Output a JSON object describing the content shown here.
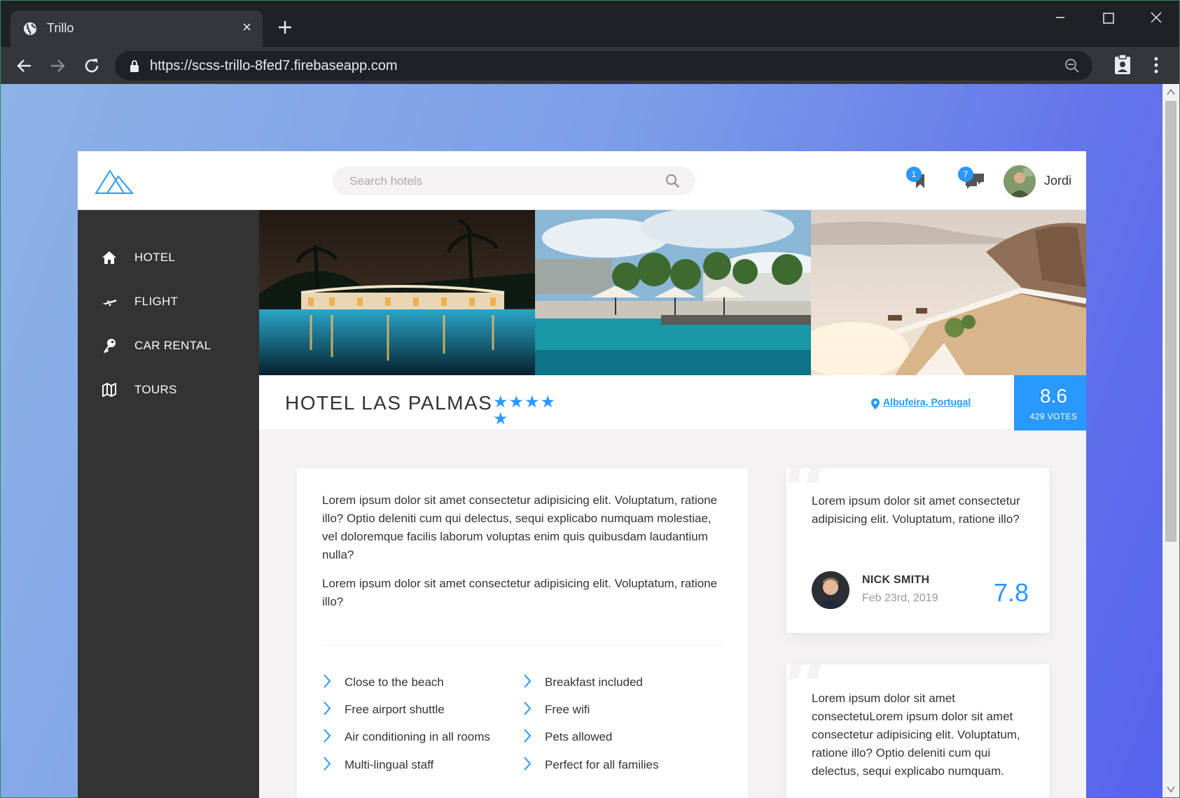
{
  "browser": {
    "tab_title": "Trillo",
    "tab_close": "×",
    "url": "https://scss-trillo-8fed7.firebaseapp.com"
  },
  "header": {
    "search_placeholder": "Search hotels",
    "bookmarks_count": "1",
    "messages_count": "7",
    "user_name": "Jordi"
  },
  "sidebar": {
    "items": [
      {
        "label": "HOTEL",
        "icon": "home-icon"
      },
      {
        "label": "FLIGHT",
        "icon": "aircraft-icon"
      },
      {
        "label": "CAR RENTAL",
        "icon": "key-icon"
      },
      {
        "label": "TOURS",
        "icon": "map-icon"
      }
    ]
  },
  "hotel": {
    "name": "HOTEL LAS PALMAS",
    "stars": 5,
    "location": "Albufeira, Portugal",
    "rating_average": "8.6",
    "rating_count": "429 VOTES"
  },
  "description": {
    "paragraph1": "Lorem ipsum dolor sit amet consectetur adipisicing elit. Voluptatum, ratione illo? Optio deleniti cum qui delectus, sequi explicabo numquam molestiae, vel doloremque facilis laborum voluptas enim quis quibusdam laudantium nulla?",
    "paragraph2": "Lorem ipsum dolor sit amet consectetur adipisicing elit. Voluptatum, ratione illo?",
    "features": [
      "Close to the beach",
      "Breakfast included",
      "Free airport shuttle",
      "Free wifi",
      "Air conditioning in all rooms",
      "Pets allowed",
      "Multi-lingual staff",
      "Perfect for all families"
    ]
  },
  "reviews": [
    {
      "text": "Lorem ipsum dolor sit amet consectetur adipisicing elit. Voluptatum, ratione illo?",
      "user": "NICK SMITH",
      "date": "Feb 23rd, 2019",
      "rating": "7.8"
    },
    {
      "text": "Lorem ipsum dolor sit amet consectetuLorem ipsum dolor sit amet consectetur adipisicing elit. Voluptatum, ratione illo? Optio deleniti cum qui delectus, sequi explicabo numquam."
    }
  ],
  "colors": {
    "primary": "#2998ff",
    "sidebar_bg": "#333333",
    "page_bg": "#f4f2f2"
  }
}
